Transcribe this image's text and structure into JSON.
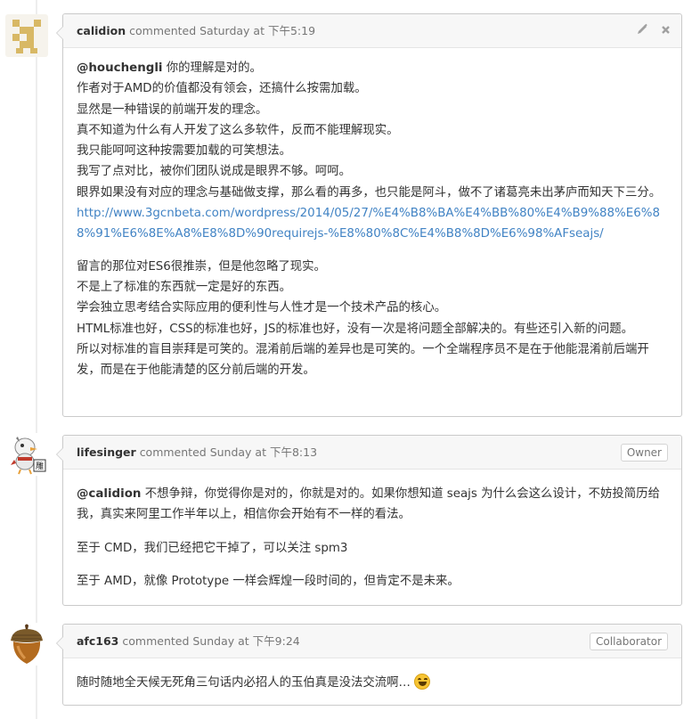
{
  "comments": [
    {
      "author": "calidion",
      "action": "commented",
      "time": "Saturday at 下午5:19",
      "badge": "",
      "tools": [
        "pencil-icon",
        "close-icon"
      ],
      "paragraphs": [
        {
          "mention": "@houchengli",
          "lines": [
            " 你的理解是对的。",
            "作者对于AMD的价值都没有领会，还搞什么按需加载。",
            "显然是一种错误的前端开发的理念。",
            "真不知道为什么有人开发了这么多软件，反而不能理解现实。",
            "我只能呵呵这种按需要加载的可笑想法。",
            "我写了点对比，被你们团队说成是眼界不够。呵呵。",
            "眼界如果没有对应的理念与基础做支撑，那么看的再多，也只能是阿斗，做不了诸葛亮未出茅庐而知天下三分。"
          ],
          "link": "http://www.3gcnbeta.com/wordpress/2014/05/27/%E4%B8%BA%E4%BB%80%E4%B9%88%E6%88%91%E6%8E%A8%E8%8D%90requirejs-%E8%80%8C%E4%B8%8D%E6%98%AFseajs/"
        },
        {
          "lines": [
            "留言的那位对ES6很推崇，但是他忽略了现实。",
            "不是上了标准的东西就一定是好的东西。",
            "学会独立思考结合实际应用的便利性与人性才是一个技术产品的核心。",
            "HTML标准也好，CSS的标准也好，JS的标准也好，没有一次是将问题全部解决的。有些还引入新的问题。",
            "所以对标准的盲目崇拜是可笑的。混淆前后端的差异也是可笑的。一个全端程序员不是在于他能混淆前后端开发，而是在于他能清楚的区分前后端的开发。"
          ]
        }
      ]
    },
    {
      "author": "lifesinger",
      "action": "commented",
      "time": "Sunday at 下午8:13",
      "badge": "Owner",
      "paragraphs": [
        {
          "mention": "@calidion",
          "text": " 不想争辩，你觉得你是对的，你就是对的。如果你想知道 seajs 为什么会这么设计，不妨投简历给我，真实来阿里工作半年以上，相信你会开始有不一样的看法。"
        },
        {
          "text": "至于 CMD，我们已经把它干掉了，可以关注 spm3"
        },
        {
          "text": "至于 AMD，就像 Prototype 一样会辉煌一段时间的，但肯定不是未来。"
        }
      ]
    },
    {
      "author": "afc163",
      "action": "commented",
      "time": "Sunday at 下午9:24",
      "badge": "Collaborator",
      "paragraphs": [
        {
          "text": "随时随地全天候无死角三句话内必招人的玉伯真是没法交流啊…",
          "emoji": "smile-emoji-icon"
        }
      ]
    }
  ]
}
